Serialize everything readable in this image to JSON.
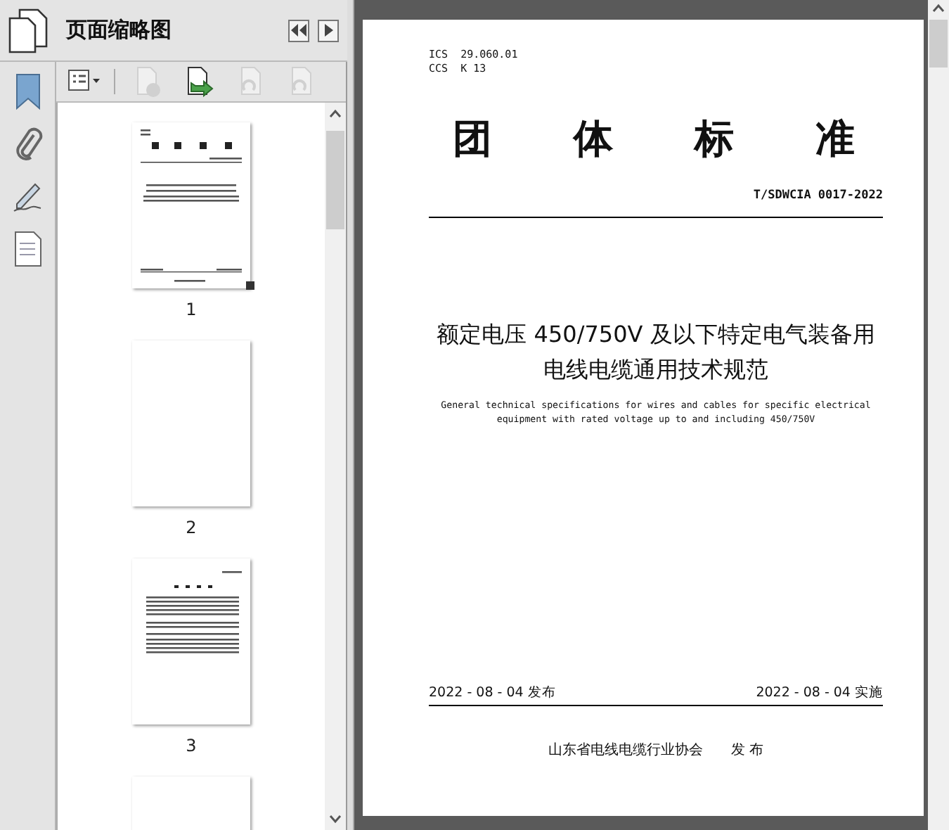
{
  "panel": {
    "title": "页面缩略图"
  },
  "toolbar": [
    {
      "kind": "options",
      "disabled": false
    },
    {
      "kind": "delete",
      "disabled": true
    },
    {
      "kind": "insert",
      "disabled": false
    },
    {
      "kind": "rotate-left",
      "disabled": true
    },
    {
      "kind": "rotate-right",
      "disabled": true
    }
  ],
  "rail": [
    {
      "kind": "bookmark"
    },
    {
      "kind": "attachment"
    },
    {
      "kind": "signature"
    },
    {
      "kind": "layers"
    }
  ],
  "thumbnails": [
    {
      "kind": "cover",
      "label": "1",
      "selected": true
    },
    {
      "kind": "blank",
      "label": "2",
      "selected": false
    },
    {
      "kind": "text",
      "label": "3",
      "selected": false
    },
    {
      "kind": "blank",
      "selected": false
    }
  ],
  "page": {
    "ics": "ICS  29.060.01",
    "ccs": "CCS  K 13",
    "heading": [
      "团",
      "体",
      "标",
      "准"
    ],
    "code": "T/SDWCIA 0017-2022",
    "title": [
      "额定电压 450/750V 及以下特定电气装备用",
      "电线电缆通用技术规范"
    ],
    "subtitle": [
      "General technical specifications for wires and cables for specific electrical",
      "equipment with rated voltage up to and including 450/750V"
    ],
    "issued": "2022 - 08 - 04 发布",
    "effective": "2022 - 08 - 04 实施",
    "publisher": "山东省电线电缆行业协会",
    "publish_action": "发 布"
  }
}
